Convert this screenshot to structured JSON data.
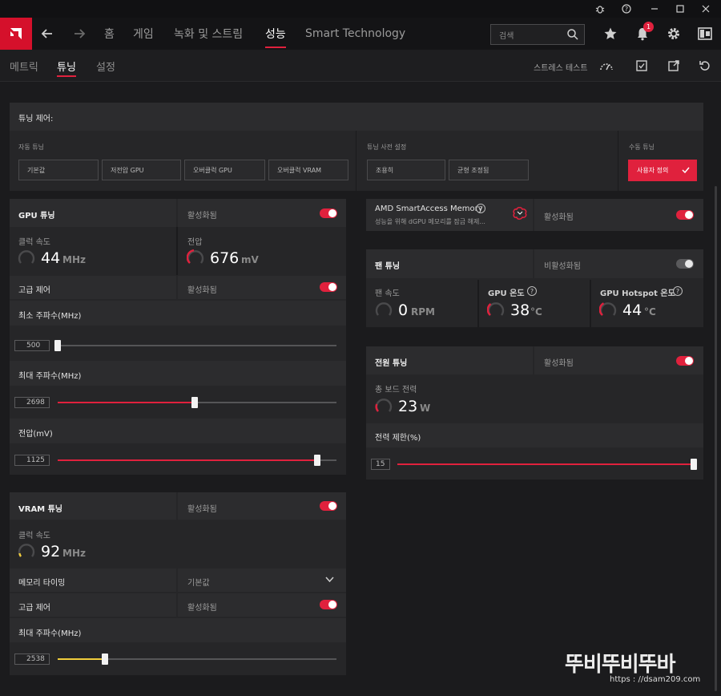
{
  "titlebar": {
    "icons": [
      "bug-icon",
      "help-icon",
      "minimize-icon",
      "maximize-icon",
      "close-icon"
    ]
  },
  "nav": {
    "items": [
      "홈",
      "게임",
      "녹화 및 스트림",
      "성능",
      "Smart Technology"
    ],
    "active": "성능",
    "search_placeholder": "검색",
    "notification_count": "1"
  },
  "subnav": {
    "tabs": [
      "메트릭",
      "튜닝",
      "설정"
    ],
    "active": "튜닝",
    "stress_test_label": "스트레스 테스트"
  },
  "tuning_control": {
    "title": "튜닝 제어:",
    "auto_tuning_label": "자동 튜닝",
    "auto_options": [
      "기본값",
      "저전압 GPU",
      "오버클럭 GPU",
      "오버클럭 VRAM"
    ],
    "preset_label": "튜닝 사전 설정",
    "preset_options": [
      "조용히",
      "균형 조정됨"
    ],
    "manual_label": "수동 튜닝",
    "manual_button": "사용자 정의"
  },
  "gpu_tuning": {
    "title": "GPU 튜닝",
    "status": "활성화됨",
    "enabled": true,
    "clock_label": "클럭 속도",
    "clock_value": "44",
    "clock_unit": "MHz",
    "voltage_label": "전압",
    "voltage_value": "676",
    "voltage_unit": "mV",
    "advanced_label": "고급 제어",
    "advanced_status": "활성화됨",
    "min_freq_label": "최소 주파수(MHz)",
    "min_freq_value": "500",
    "min_freq_fraction": 0.0,
    "max_freq_label": "최대 주파수(MHz)",
    "max_freq_value": "2698",
    "max_freq_fraction": 0.49,
    "voltage_slider_label": "전압(mV)",
    "voltage_slider_value": "1125",
    "voltage_slider_fraction": 0.93
  },
  "vram_tuning": {
    "title": "VRAM 튜닝",
    "status": "활성화됨",
    "enabled": true,
    "clock_label": "클럭 속도",
    "clock_value": "92",
    "clock_unit": "MHz",
    "memory_timing_label": "메모리 타이밍",
    "memory_timing_value": "기본값",
    "advanced_label": "고급 제어",
    "advanced_status": "활성화됨",
    "max_freq_label": "최대 주파수(MHz)",
    "max_freq_value": "2538",
    "max_freq_fraction": 0.17
  },
  "smart_access_memory": {
    "title": "AMD SmartAccess Memory",
    "description": "성능을 위해 dGPU 메모리를 잠금 해제...",
    "status": "활성화됨",
    "enabled": true
  },
  "fan_tuning": {
    "title": "팬 튜닝",
    "status": "비활성화됨",
    "enabled": false,
    "fan_speed_label": "팬 속도",
    "fan_speed_value": "0",
    "fan_speed_unit": "RPM",
    "gpu_temp_label": "GPU 온도",
    "gpu_temp_value": "38",
    "gpu_temp_unit": "°C",
    "hotspot_label": "GPU Hotspot 온도",
    "hotspot_value": "44",
    "hotspot_unit": "°C"
  },
  "power_tuning": {
    "title": "전원 튜닝",
    "status": "활성화됨",
    "enabled": true,
    "board_power_label": "총 보드 전력",
    "board_power_value": "23",
    "board_power_unit": "W",
    "power_limit_label": "전력 제한(%)",
    "power_limit_value": "15",
    "power_limit_fraction": 1.0
  },
  "watermark": {
    "text": "뚜비뚜비뚜바",
    "url": "https : //dsam209.com"
  },
  "colors": {
    "accent": "#e0213d",
    "yellow": "#f0cc3c",
    "background": "#1b1b1d",
    "card": "#262628"
  }
}
